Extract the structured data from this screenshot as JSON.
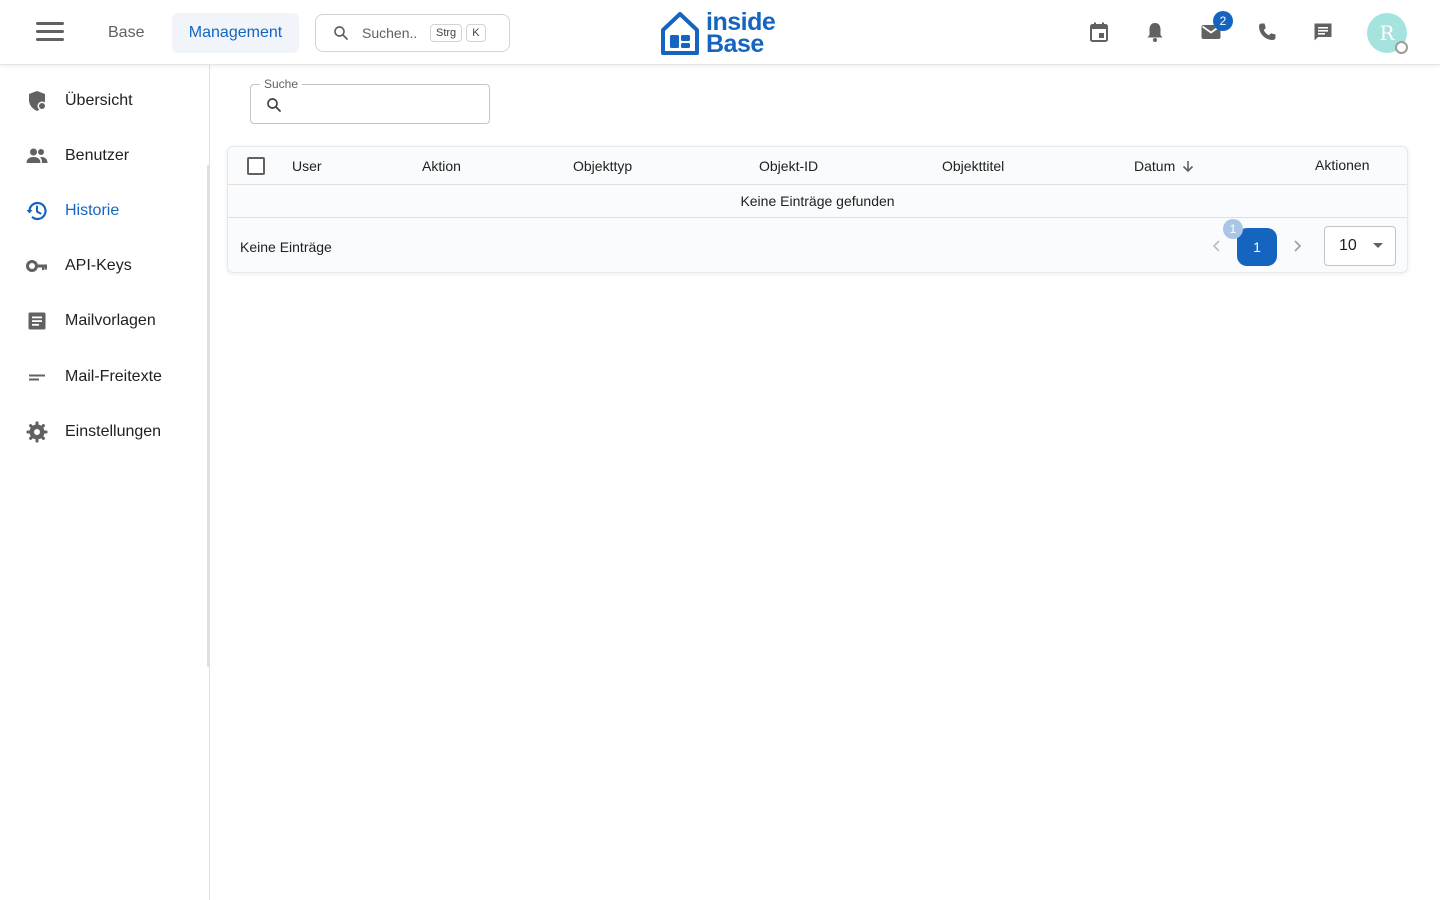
{
  "header": {
    "menu_icon": "hamburger-menu-icon",
    "tabs": [
      {
        "label": "Base"
      },
      {
        "label": "Management",
        "active": true
      }
    ],
    "search": {
      "placeholder": "Suchen...",
      "shortcut_key1": "Strg",
      "shortcut_key2": "K"
    },
    "logo": {
      "line1": "inside",
      "line2": "Base"
    },
    "icons": [
      "calendar-icon",
      "bell-icon",
      "mail-icon",
      "phone-icon",
      "chat-icon"
    ],
    "mail_badge": "2",
    "avatar": "R"
  },
  "sidebar": {
    "items": [
      {
        "label": "Übersicht",
        "icon": "shield-icon"
      },
      {
        "label": "Benutzer",
        "icon": "people-icon"
      },
      {
        "label": "Historie",
        "icon": "history-icon",
        "active": true
      },
      {
        "label": "API-Keys",
        "icon": "key-icon"
      },
      {
        "label": "Mailvorlagen",
        "icon": "article-icon"
      },
      {
        "label": "Mail-Freitexte",
        "icon": "short-text-icon"
      },
      {
        "label": "Einstellungen",
        "icon": "gear-icon"
      }
    ]
  },
  "main": {
    "search_label": "Suche",
    "table": {
      "columns": [
        "User",
        "Aktion",
        "Objekttyp",
        "Objekt-ID",
        "Objekttitel",
        "Datum",
        "Aktionen"
      ],
      "empty_text": "Keine Einträge gefunden",
      "footer_text": "Keine Einträge",
      "current_page": "1",
      "page_bubble": "1",
      "per_page": "10"
    }
  },
  "colors": {
    "accent": "#1565c0",
    "avatar_bg": "#a5e3df"
  }
}
